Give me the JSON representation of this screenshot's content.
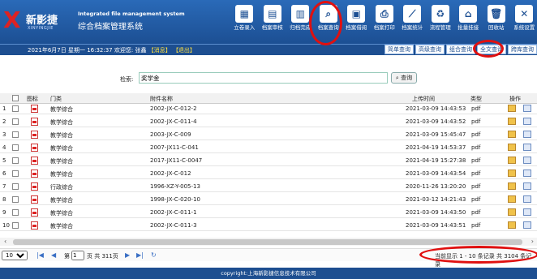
{
  "logo": {
    "mark": "X",
    "brand": "新影捷",
    "sub": "XINYINGJIE"
  },
  "system": {
    "title_en": "Integrated file management system",
    "title_cn": "综合档案管理系统"
  },
  "toolbar": [
    {
      "label": "立卷录入",
      "icon": "folder-entry-icon",
      "glyph": "▦"
    },
    {
      "label": "档案审核",
      "icon": "audit-icon",
      "glyph": "▤"
    },
    {
      "label": "归档完成",
      "icon": "archive-done-icon",
      "glyph": "▥"
    },
    {
      "label": "档案查询",
      "icon": "document-search-icon",
      "glyph": "⌕"
    },
    {
      "label": "档案借阅",
      "icon": "borrow-icon",
      "glyph": "▣"
    },
    {
      "label": "档案打印",
      "icon": "print-icon",
      "glyph": "⎙"
    },
    {
      "label": "档案统计",
      "icon": "statistics-icon",
      "glyph": "⟋"
    },
    {
      "label": "流程管理",
      "icon": "workflow-icon",
      "glyph": "♻"
    },
    {
      "label": "批量挂接",
      "icon": "home-icon",
      "glyph": "⌂"
    },
    {
      "label": "回收站",
      "icon": "trash-icon",
      "glyph": "🗑"
    },
    {
      "label": "系统设置",
      "icon": "settings-icon",
      "glyph": "✕"
    }
  ],
  "status": {
    "date": "2021年6月7日 星期一",
    "time": "16:32:37",
    "welcome": "欢迎您: 张鑫",
    "message": "【消息】",
    "logout": "【退出】"
  },
  "query_tabs": [
    "简单查询",
    "高级查询",
    "组合查询",
    "全文查询",
    "跨库查询"
  ],
  "search": {
    "label": "检索:",
    "value": "奖学金",
    "button": "查询"
  },
  "table": {
    "headers": {
      "icon": "图标",
      "category": "门类",
      "name": "附件名称",
      "time": "上传时间",
      "type": "类型",
      "op": "操作"
    },
    "rows": [
      {
        "n": "1",
        "category": "教学综合",
        "name": "2002-JX-C-012-2",
        "time": "2021-03-09 14:43:53",
        "type": "pdf"
      },
      {
        "n": "2",
        "category": "教学综合",
        "name": "2002-JX-C-011-4",
        "time": "2021-03-09 14:43:52",
        "type": "pdf"
      },
      {
        "n": "3",
        "category": "教学综合",
        "name": "2003-JX-C-009",
        "time": "2021-03-09 15:45:47",
        "type": "pdf"
      },
      {
        "n": "4",
        "category": "教学综合",
        "name": "2007-JX11-C-041",
        "time": "2021-04-19 14:53:37",
        "type": "pdf"
      },
      {
        "n": "5",
        "category": "教学综合",
        "name": "2017-JX11-C-0047",
        "time": "2021-04-19 15:27:38",
        "type": "pdf"
      },
      {
        "n": "6",
        "category": "教学综合",
        "name": "2002-JX-C-012",
        "time": "2021-03-09 14:43:54",
        "type": "pdf"
      },
      {
        "n": "7",
        "category": "行政综合",
        "name": "1996-XZ-Y-005-13",
        "time": "2020-11-26 13:20:20",
        "type": "pdf"
      },
      {
        "n": "8",
        "category": "教学综合",
        "name": "1998-JX-C-020-10",
        "time": "2021-03-12 14:21:43",
        "type": "pdf"
      },
      {
        "n": "9",
        "category": "教学综合",
        "name": "2002-JX-C-011-1",
        "time": "2021-03-09 14:43:50",
        "type": "pdf"
      },
      {
        "n": "10",
        "category": "教学综合",
        "name": "2002-JX-C-011-3",
        "time": "2021-03-09 14:43:51",
        "type": "pdf"
      }
    ]
  },
  "pager": {
    "page_size": "10",
    "page_prefix": "第",
    "page": "1",
    "total_pages": "页 共 311页",
    "info": "当前显示 1 - 10 条记录 共 3104 条记录"
  },
  "footer": "copyright:上海新影捷信息技术有限公司",
  "colors": {
    "header": "#1c4f93",
    "highlight": "#e01010"
  }
}
